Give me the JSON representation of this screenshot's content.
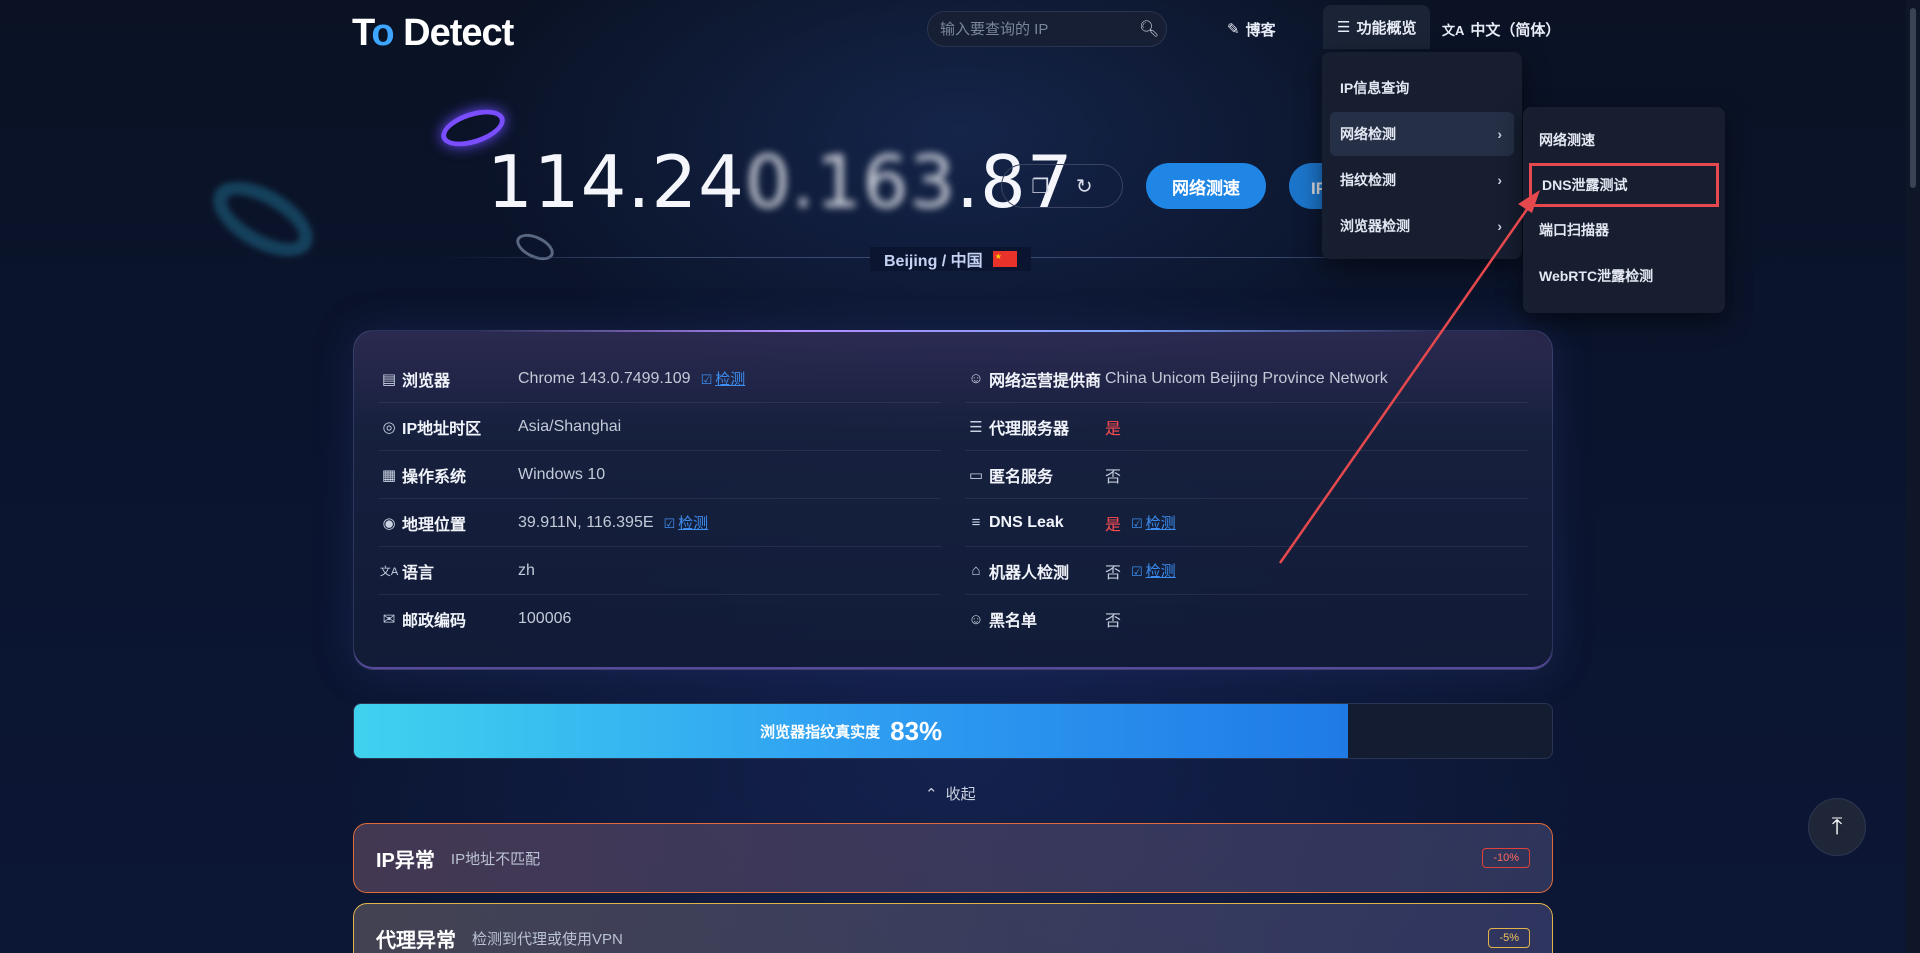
{
  "header": {
    "logo": "To Detect",
    "search_placeholder": "输入要查询的 IP",
    "nav": {
      "blog": "博客",
      "features": "功能概览",
      "language": "中文（简体）"
    }
  },
  "menu_features": {
    "items": [
      {
        "label": "IP信息查询"
      },
      {
        "label": "网络检测"
      },
      {
        "label": "指纹检测"
      },
      {
        "label": "浏览器检测"
      }
    ]
  },
  "menu_network": {
    "items": [
      {
        "label": "网络测速"
      },
      {
        "label": "DNS泄露测试"
      },
      {
        "label": "端口扫描器"
      },
      {
        "label": "WebRTC泄露检测"
      }
    ]
  },
  "hero": {
    "ip_visible": "114.24",
    "ip_blurred": "0.163",
    "ip_tail": ".87",
    "btn_speed": "网络测速",
    "btn_ipinfo": "IP信息查询",
    "location": "Beijing / 中国"
  },
  "info": {
    "browser": {
      "label": "浏览器",
      "value": "Chrome 143.0.7499.109",
      "check": "检测"
    },
    "isp": {
      "label": "网络运营提供商",
      "value": "China Unicom Beijing Province Network"
    },
    "timezone": {
      "label": "IP地址时区",
      "value": "Asia/Shanghai"
    },
    "proxy": {
      "label": "代理服务器",
      "value": "是"
    },
    "os": {
      "label": "操作系统",
      "value": "Windows 10"
    },
    "anonymous": {
      "label": "匿名服务",
      "value": "否"
    },
    "geo": {
      "label": "地理位置",
      "value": "39.911N, 116.395E",
      "check": "检测"
    },
    "dns_leak": {
      "label": "DNS Leak",
      "value": "是",
      "check": "检测"
    },
    "language": {
      "label": "语言",
      "value": "zh"
    },
    "bot": {
      "label": "机器人检测",
      "value": "否",
      "check": "检测"
    },
    "postcode": {
      "label": "邮政编码",
      "value": "100006"
    },
    "blacklist": {
      "label": "黑名单",
      "value": "否"
    }
  },
  "fingerprint": {
    "label": "浏览器指纹真实度",
    "value": "83%",
    "percent": 83
  },
  "collapse_label": "收起",
  "alerts": [
    {
      "title": "IP异常",
      "desc": "IP地址不匹配",
      "badge": "-10%"
    },
    {
      "title": "代理异常",
      "desc": "检测到代理或使用VPN",
      "badge": "-5%"
    }
  ],
  "colors": {
    "accent": "#1f86e6",
    "danger": "#ff4d4f",
    "warning": "#e2b34a",
    "highlight_box": "#e5484d"
  }
}
